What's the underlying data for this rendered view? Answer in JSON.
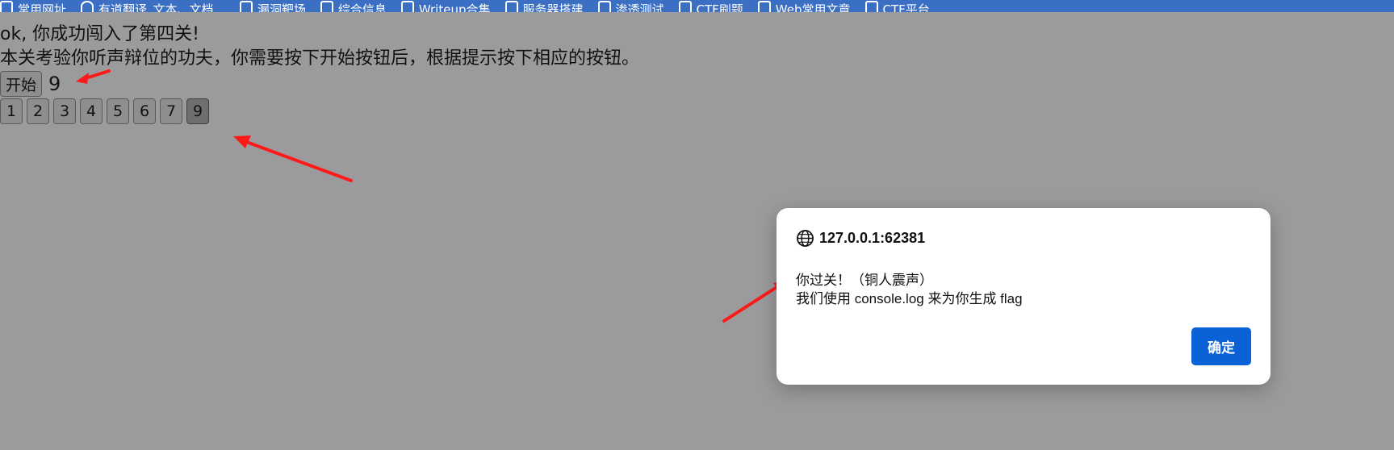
{
  "bookmarks": [
    {
      "label": "常用网址",
      "icon": "folder-icon"
    },
    {
      "label": "有道翻译_文本、文档...",
      "icon": "globe-icon"
    },
    {
      "label": "漏洞靶场",
      "icon": "folder-icon"
    },
    {
      "label": "综合信息",
      "icon": "folder-icon"
    },
    {
      "label": "Writeup合集",
      "icon": "folder-icon"
    },
    {
      "label": "服务器搭建",
      "icon": "folder-icon"
    },
    {
      "label": "渗透测试",
      "icon": "folder-icon"
    },
    {
      "label": "CTF刷题",
      "icon": "folder-icon"
    },
    {
      "label": "Web常用文章",
      "icon": "folder-icon"
    },
    {
      "label": "CTF平台",
      "icon": "folder-icon"
    }
  ],
  "page": {
    "line1": "ok, 你成功闯入了第四关!",
    "line2": "本关考验你听声辩位的功夫，你需要按下开始按钮后，根据提示按下相应的按钮。",
    "start_label": "开始",
    "result_value": "9",
    "buttons": [
      "1",
      "2",
      "3",
      "4",
      "5",
      "6",
      "7",
      "9"
    ]
  },
  "dialog": {
    "origin": "127.0.0.1:62381",
    "message_line1": "你过关！（铜人震声）",
    "message_line2": "我们使用 console.log 来为你生成 flag",
    "ok_label": "确定"
  },
  "colors": {
    "background": "#9b9b9d",
    "bookmark_bar": "#3b6fc4",
    "ok_button": "#0b62d6",
    "annotation_arrow": "#ff1a1a"
  }
}
